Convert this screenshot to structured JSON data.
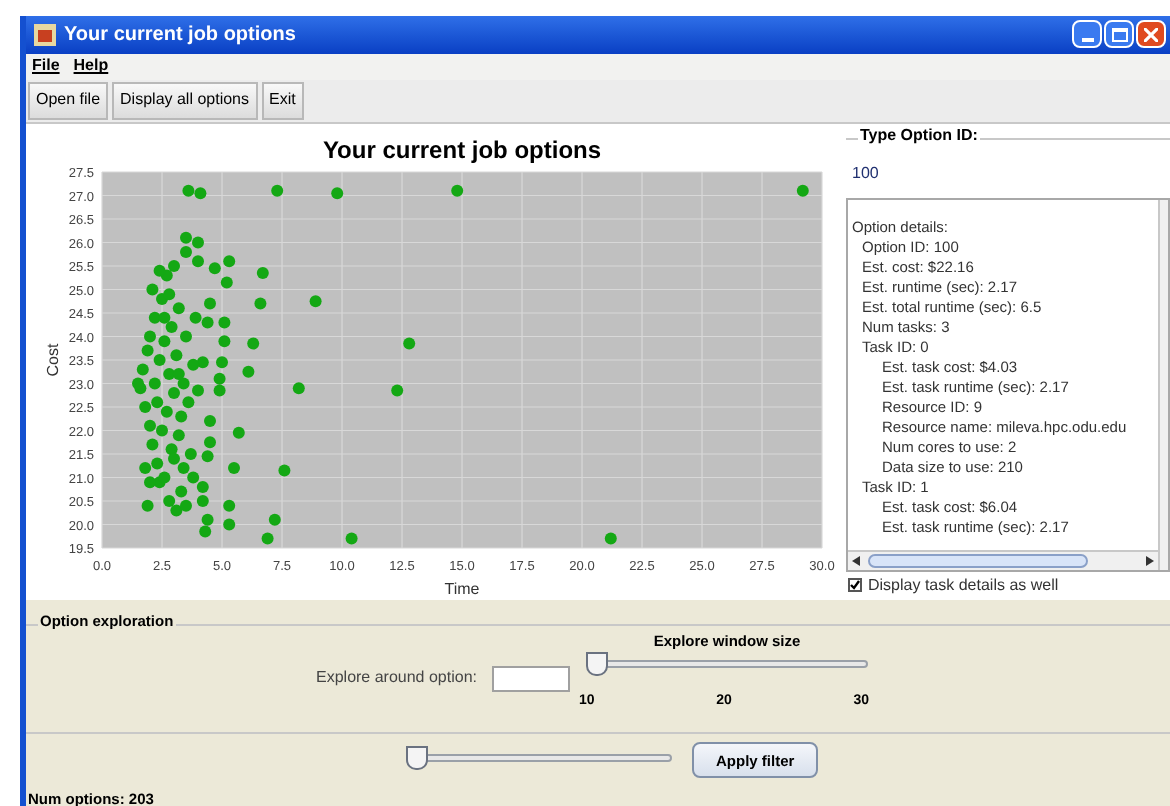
{
  "window": {
    "title": "Your current job options"
  },
  "menu": [
    "File",
    "Help"
  ],
  "toolbar": [
    "Open file",
    "Display all options",
    "Exit"
  ],
  "chart": {
    "chart_data": {
      "type": "scatter",
      "grid": true,
      "title": "Your current job options",
      "xlabel": "Time",
      "ylabel": "Cost",
      "xlim": [
        0,
        30
      ],
      "ylim": [
        19.5,
        27.5
      ],
      "xticks": [
        {
          "value": 0,
          "label": "0.0"
        },
        {
          "value": 2.5,
          "label": "2.5"
        },
        {
          "value": 5,
          "label": "5.0"
        },
        {
          "value": 7.5,
          "label": "7.5"
        },
        {
          "value": 10,
          "label": "10.0"
        },
        {
          "value": 12.5,
          "label": "12.5"
        },
        {
          "value": 15,
          "label": "15.0"
        },
        {
          "value": 17.5,
          "label": "17.5"
        },
        {
          "value": 20,
          "label": "20.0"
        },
        {
          "value": 22.5,
          "label": "22.5"
        },
        {
          "value": 25,
          "label": "25.0"
        },
        {
          "value": 27.5,
          "label": "27.5"
        },
        {
          "value": 30,
          "label": "30.0"
        }
      ],
      "yticks": [
        {
          "value": 19.5,
          "label": "19.5"
        },
        {
          "value": 20,
          "label": "20.0"
        },
        {
          "value": 20.5,
          "label": "20.5"
        },
        {
          "value": 21,
          "label": "21.0"
        },
        {
          "value": 21.5,
          "label": "21.5"
        },
        {
          "value": 22,
          "label": "22.0"
        },
        {
          "value": 22.5,
          "label": "22.5"
        },
        {
          "value": 23,
          "label": "23.0"
        },
        {
          "value": 23.5,
          "label": "23.5"
        },
        {
          "value": 24,
          "label": "24.0"
        },
        {
          "value": 24.5,
          "label": "24.5"
        },
        {
          "value": 25,
          "label": "25.0"
        },
        {
          "value": 25.5,
          "label": "25.5"
        },
        {
          "value": 26,
          "label": "26.0"
        },
        {
          "value": 26.5,
          "label": "26.5"
        },
        {
          "value": 27,
          "label": "27.0"
        },
        {
          "value": 27.5,
          "label": "27.5"
        }
      ],
      "x": [
        3.6,
        4.1,
        7.3,
        9.8,
        14.8,
        29.2,
        3.5,
        4.0,
        3.5,
        4.0,
        5.3,
        4.7,
        6.7,
        5.2,
        4.5,
        6.6,
        8.9,
        4.4,
        5.1,
        6.3,
        12.8,
        5.1,
        4.2,
        5.0,
        6.1,
        4.9,
        8.2,
        12.3,
        4.9,
        4.0,
        4.5,
        5.7,
        4.5,
        4.4,
        5.5,
        7.6,
        4.2,
        4.2,
        5.3,
        4.4,
        7.2,
        5.3,
        4.3,
        6.9,
        10.4,
        21.2,
        1.6,
        1.7,
        1.8,
        1.9,
        2.0,
        2.0,
        2.1,
        2.2,
        2.2,
        2.3,
        2.3,
        2.4,
        2.4,
        2.5,
        2.5,
        2.6,
        2.6,
        2.7,
        2.7,
        2.8,
        2.8,
        2.9,
        2.9,
        3.0,
        3.0,
        3.1,
        3.1,
        3.2,
        3.2,
        3.3,
        3.3,
        3.4,
        3.4,
        3.5,
        3.5,
        1.8,
        1.9,
        2.1,
        2.4,
        3.6,
        3.7,
        3.8,
        3.9,
        3.8,
        1.5,
        2.0,
        2.6,
        3.0,
        3.2,
        2.8
      ],
      "series": [
        {
          "color": "#14a814",
          "values": [
            27.1,
            27.05,
            27.1,
            27.05,
            27.1,
            27.1,
            26.1,
            26.0,
            25.8,
            25.6,
            25.6,
            25.45,
            25.35,
            25.15,
            24.7,
            24.7,
            24.75,
            24.3,
            24.3,
            23.85,
            23.85,
            23.9,
            23.45,
            23.45,
            23.25,
            23.1,
            22.9,
            22.85,
            22.85,
            22.85,
            22.2,
            21.95,
            21.75,
            21.45,
            21.2,
            21.15,
            20.8,
            20.5,
            20.4,
            20.1,
            20.1,
            20.0,
            19.85,
            19.7,
            19.7,
            19.7,
            22.9,
            23.3,
            22.5,
            23.7,
            22.1,
            24.0,
            21.7,
            23.0,
            24.4,
            21.3,
            22.6,
            23.5,
            20.9,
            24.8,
            22.0,
            23.9,
            21.0,
            25.3,
            22.4,
            23.2,
            20.5,
            24.2,
            21.6,
            25.5,
            22.8,
            20.3,
            23.6,
            21.9,
            24.6,
            20.7,
            22.3,
            23.0,
            21.2,
            24.0,
            20.4,
            21.2,
            20.4,
            25.0,
            25.4,
            22.6,
            21.5,
            23.4,
            24.4,
            21.0,
            23.0,
            20.9,
            24.4,
            21.4,
            23.2,
            24.9
          ]
        }
      ]
    }
  },
  "option_id": {
    "label": "Type Option ID:",
    "value": "100"
  },
  "details": {
    "heading": "Option details:",
    "items": [
      {
        "text": "Option ID: 100"
      },
      {
        "text": "Est. cost: $22.16"
      },
      {
        "text": "Est. runtime (sec): 2.17"
      },
      {
        "text": "Est. total runtime (sec): 6.5"
      },
      {
        "text": "Num tasks: 3"
      },
      {
        "text": "Task ID: 0",
        "children": [
          {
            "text": "Est. task cost: $4.03"
          },
          {
            "text": "Est. task runtime (sec): 2.17"
          },
          {
            "text": "Resource ID: 9"
          },
          {
            "text": "Resource name: mileva.hpc.odu.edu"
          },
          {
            "text": "Num cores to use: 2"
          },
          {
            "text": "Data size to use: 210"
          }
        ]
      },
      {
        "text": "Task ID: 1",
        "children": [
          {
            "text": "Est. task cost: $6.04"
          },
          {
            "text": "Est. task runtime (sec): 2.17"
          }
        ]
      }
    ]
  },
  "show_task_details": {
    "label": "Display task details as well",
    "checked": true
  },
  "exploration": {
    "title": "Option exploration",
    "around_label": "Explore around option:",
    "window_size": {
      "title": "Explore window size",
      "level": 0,
      "ticks": [
        "10",
        "20",
        "30"
      ]
    }
  },
  "filter": {
    "level": 0,
    "button": "Apply filter"
  },
  "status": "Num options: 203"
}
